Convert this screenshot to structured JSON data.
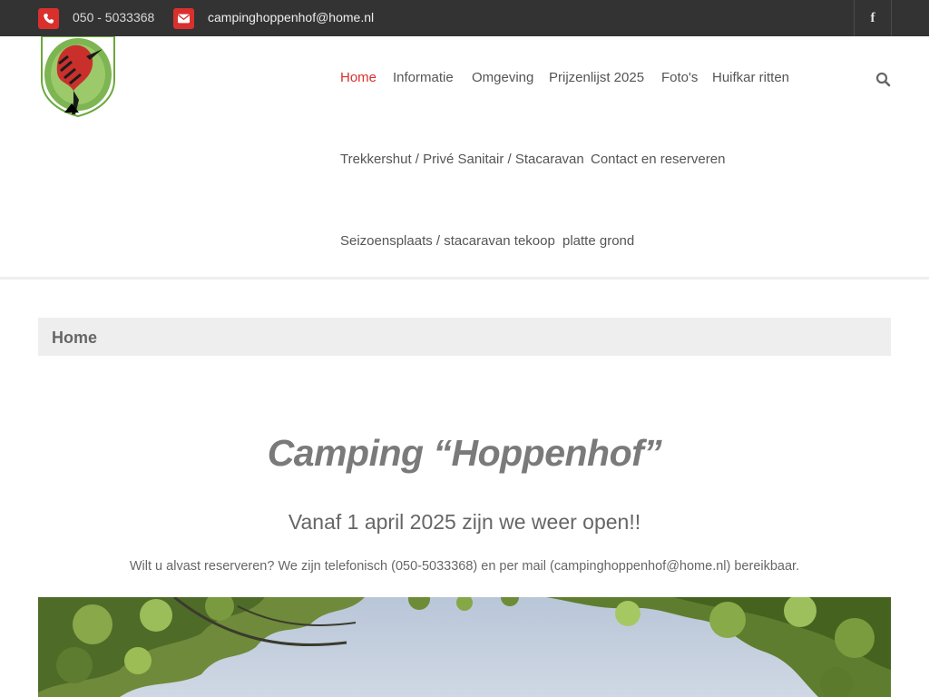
{
  "topbar": {
    "phone": "050 - 5033368",
    "email": "campinghoppenhof@home.nl",
    "phone_icon": "phone-icon",
    "email_icon": "envelope-icon",
    "social_icon": "facebook-icon",
    "social_label": "f",
    "accent": "#d9302e",
    "background": "#333333"
  },
  "nav": {
    "items": [
      {
        "label": "Home",
        "active": true
      },
      {
        "label": "Informatie"
      },
      {
        "label": "Omgeving"
      },
      {
        "label": "Prijzenlijst 2025"
      },
      {
        "label": "Foto's"
      },
      {
        "label": "Huifkar ritten"
      },
      {
        "label": "Trekkershut / Privé Sanitair / Stacaravan"
      },
      {
        "label": "Contact en reserveren"
      },
      {
        "label": "Seizoensplaats / stacaravan tekoop"
      },
      {
        "label": "platte grond"
      }
    ],
    "search_icon": "search-icon",
    "active_color": "#d9302e"
  },
  "breadcrumb": {
    "title": "Home"
  },
  "content": {
    "title": "Camping “Hoppenhof”",
    "subtitle": "Vanaf 1 april 2025 zijn we weer open!!",
    "info": "Wilt u alvast reserveren? We zijn telefonisch (050-5033368) en per mail (campinghoppenhof@home.nl) bereikbaar."
  }
}
